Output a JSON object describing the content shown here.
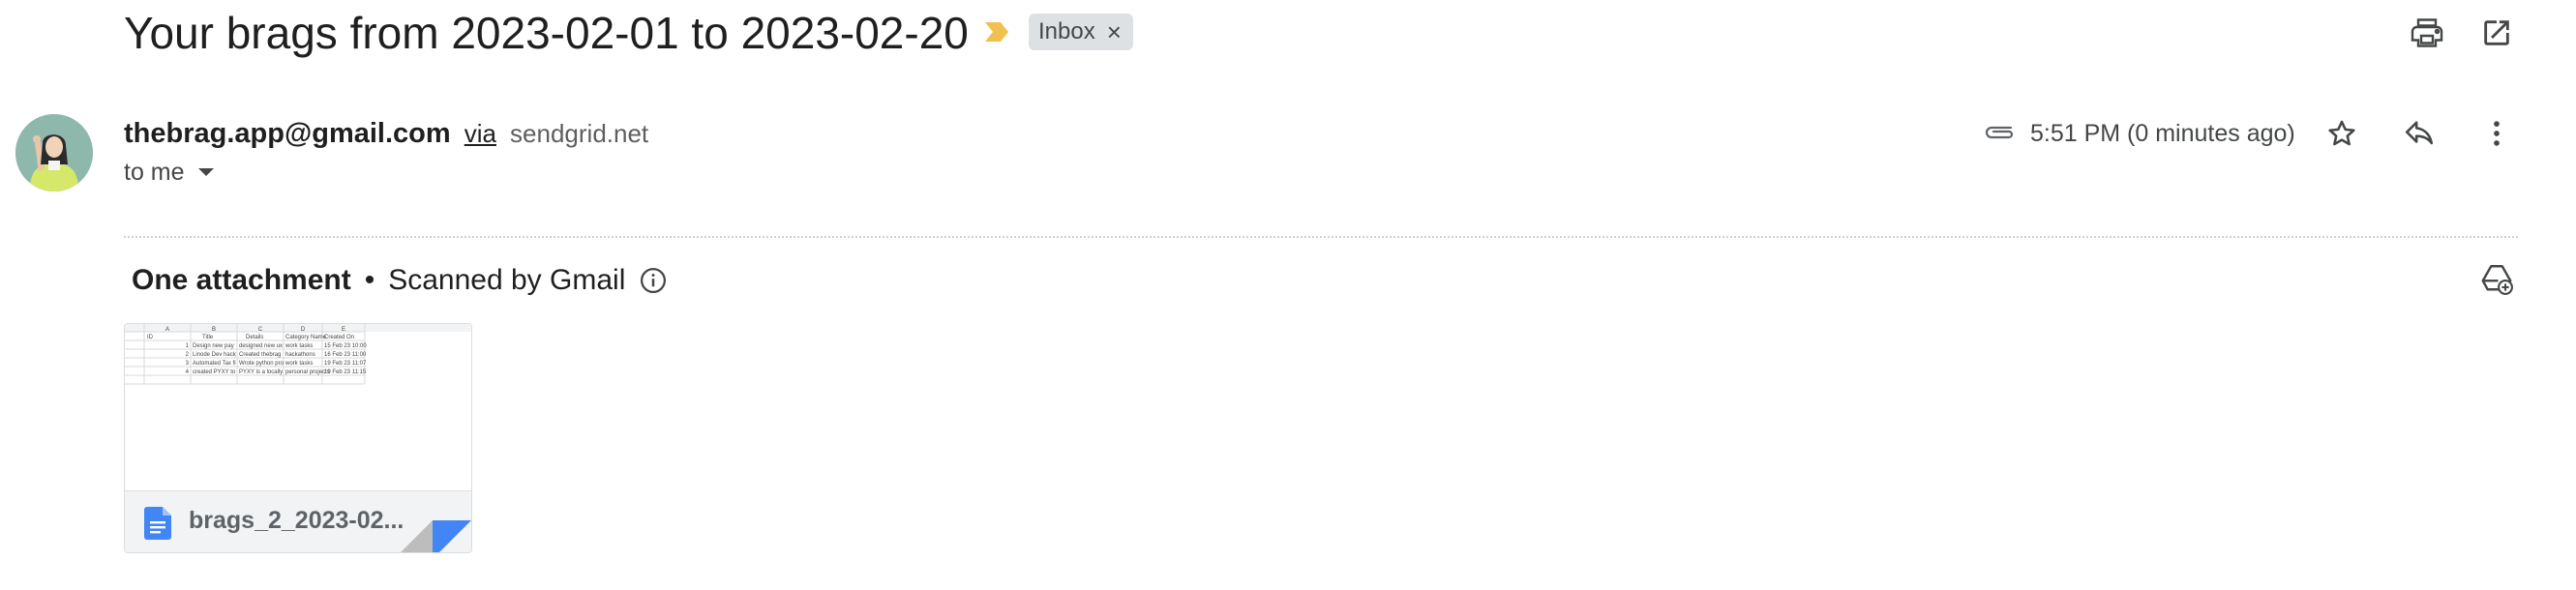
{
  "email": {
    "subject": "Your brags from 2023-02-01 to 2023-02-20",
    "label_chip": "Inbox",
    "label_chip_close": "×",
    "sender_email": "thebrag.app@gmail.com",
    "via_text": "via",
    "via_domain": "sendgrid.net",
    "recipient_text": "to me",
    "time_text": "5:51 PM (0 minutes ago)"
  },
  "attachments": {
    "count_label": "One attachment",
    "bullet": "•",
    "scan_text": "Scanned by Gmail",
    "items": [
      {
        "file_name": "brags_2_2023-02...",
        "preview": {
          "col_letters": [
            "A",
            "B",
            "C",
            "D",
            "E"
          ],
          "headers": [
            "ID",
            "Title",
            "Details",
            "Category Name",
            "Created On"
          ],
          "rows": [
            [
              "1",
              "Design new pay",
              "designed new ux",
              "work tasks",
              "15 Feb 23 10:00"
            ],
            [
              "2",
              "Linode Dev hack",
              "Created thebrag",
              "hackathons",
              "16 Feb 23 11:00"
            ],
            [
              "3",
              "Automated Tax fi",
              "Wrote python pro",
              "work tasks",
              "19 Feb 23 11:07"
            ],
            [
              "4",
              "created PYXY to",
              "PYXY is a locally",
              "personal projects",
              "19 Feb 23 11:15"
            ]
          ]
        }
      }
    ]
  },
  "icons": {
    "importance": "importance-marker-icon",
    "print": "print-icon",
    "open_new_window": "open-in-new-window-icon",
    "attachment": "paperclip-icon",
    "star": "star-icon",
    "reply": "reply-icon",
    "more": "more-vert-icon",
    "info": "info-icon",
    "add_to_drive": "add-to-drive-icon",
    "doc": "google-doc-icon",
    "dropdown": "arrow-drop-down-icon"
  },
  "colors": {
    "importance": "#f2c04f",
    "chip_bg": "#dde1e3",
    "doc_blue": "#4285f4"
  }
}
